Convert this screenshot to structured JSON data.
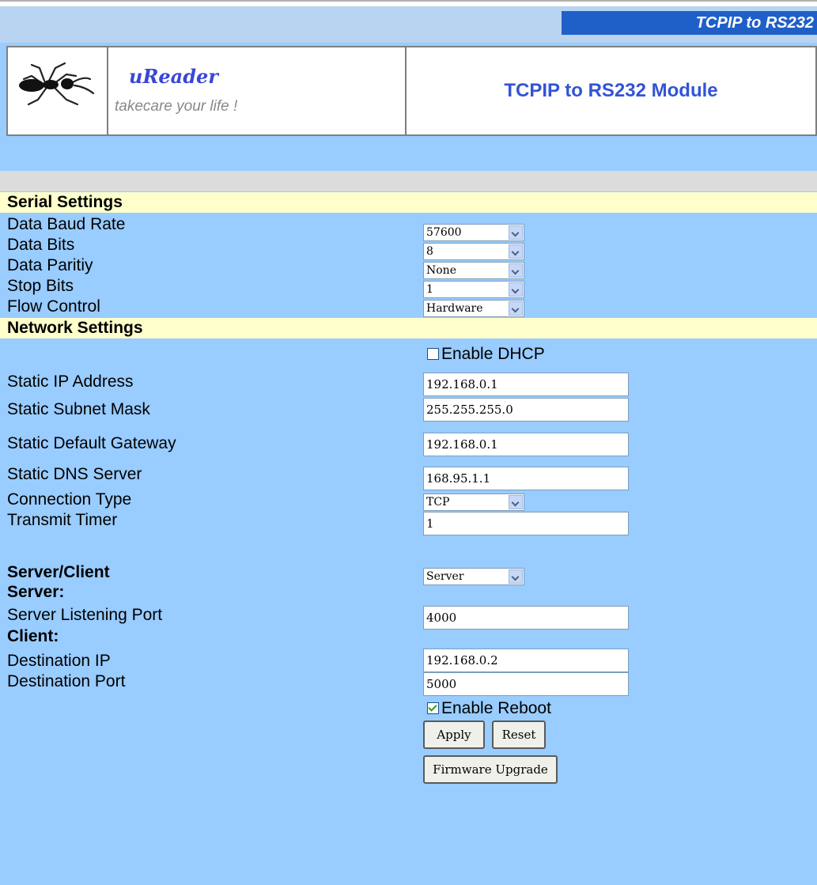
{
  "header": {
    "tab_title": "TCPIP to RS232",
    "brand": "uReader",
    "slogan": "takecare your life !",
    "module_title": "TCPIP to RS232 Module"
  },
  "serial": {
    "heading": "Serial Settings",
    "baud_label": "Data Baud Rate",
    "baud_value": "57600",
    "bits_label": "Data Bits",
    "bits_value": "8",
    "parity_label": "Data Paritiy",
    "parity_value": "None",
    "stop_label": "Stop Bits",
    "stop_value": "1",
    "flow_label": "Flow Control",
    "flow_value": "Hardware"
  },
  "network": {
    "heading": "Network Settings",
    "dhcp_label": "Enable DHCP",
    "dhcp_checked": false,
    "ip_label": "Static IP Address",
    "ip_value": "192.168.0.1",
    "mask_label": "Static Subnet Mask",
    "mask_value": "255.255.255.0",
    "gateway_label": "Static Default Gateway",
    "gateway_value": "192.168.0.1",
    "dns_label": "Static DNS Server",
    "dns_value": "168.95.1.1",
    "conn_label": "Connection Type",
    "conn_value": "TCP",
    "timer_label": "Transmit Timer",
    "timer_value": "1"
  },
  "mode": {
    "server_client_label": "Server/Client",
    "server_client_value": "Server",
    "server_heading": "Server:",
    "listen_label": "Server Listening Port",
    "listen_value": "4000",
    "client_heading": "Client:",
    "dest_ip_label": "Destination IP",
    "dest_ip_value": "192.168.0.2",
    "dest_port_label": "Destination Port",
    "dest_port_value": "5000",
    "reboot_label": "Enable Reboot",
    "reboot_checked": true
  },
  "buttons": {
    "apply": "Apply",
    "reset": "Reset",
    "firmware": "Firmware Upgrade"
  },
  "colors": {
    "background": "#99ccff",
    "section": "#ffffcc",
    "tab": "#1f5fc8",
    "title_text": "#3354d6"
  }
}
